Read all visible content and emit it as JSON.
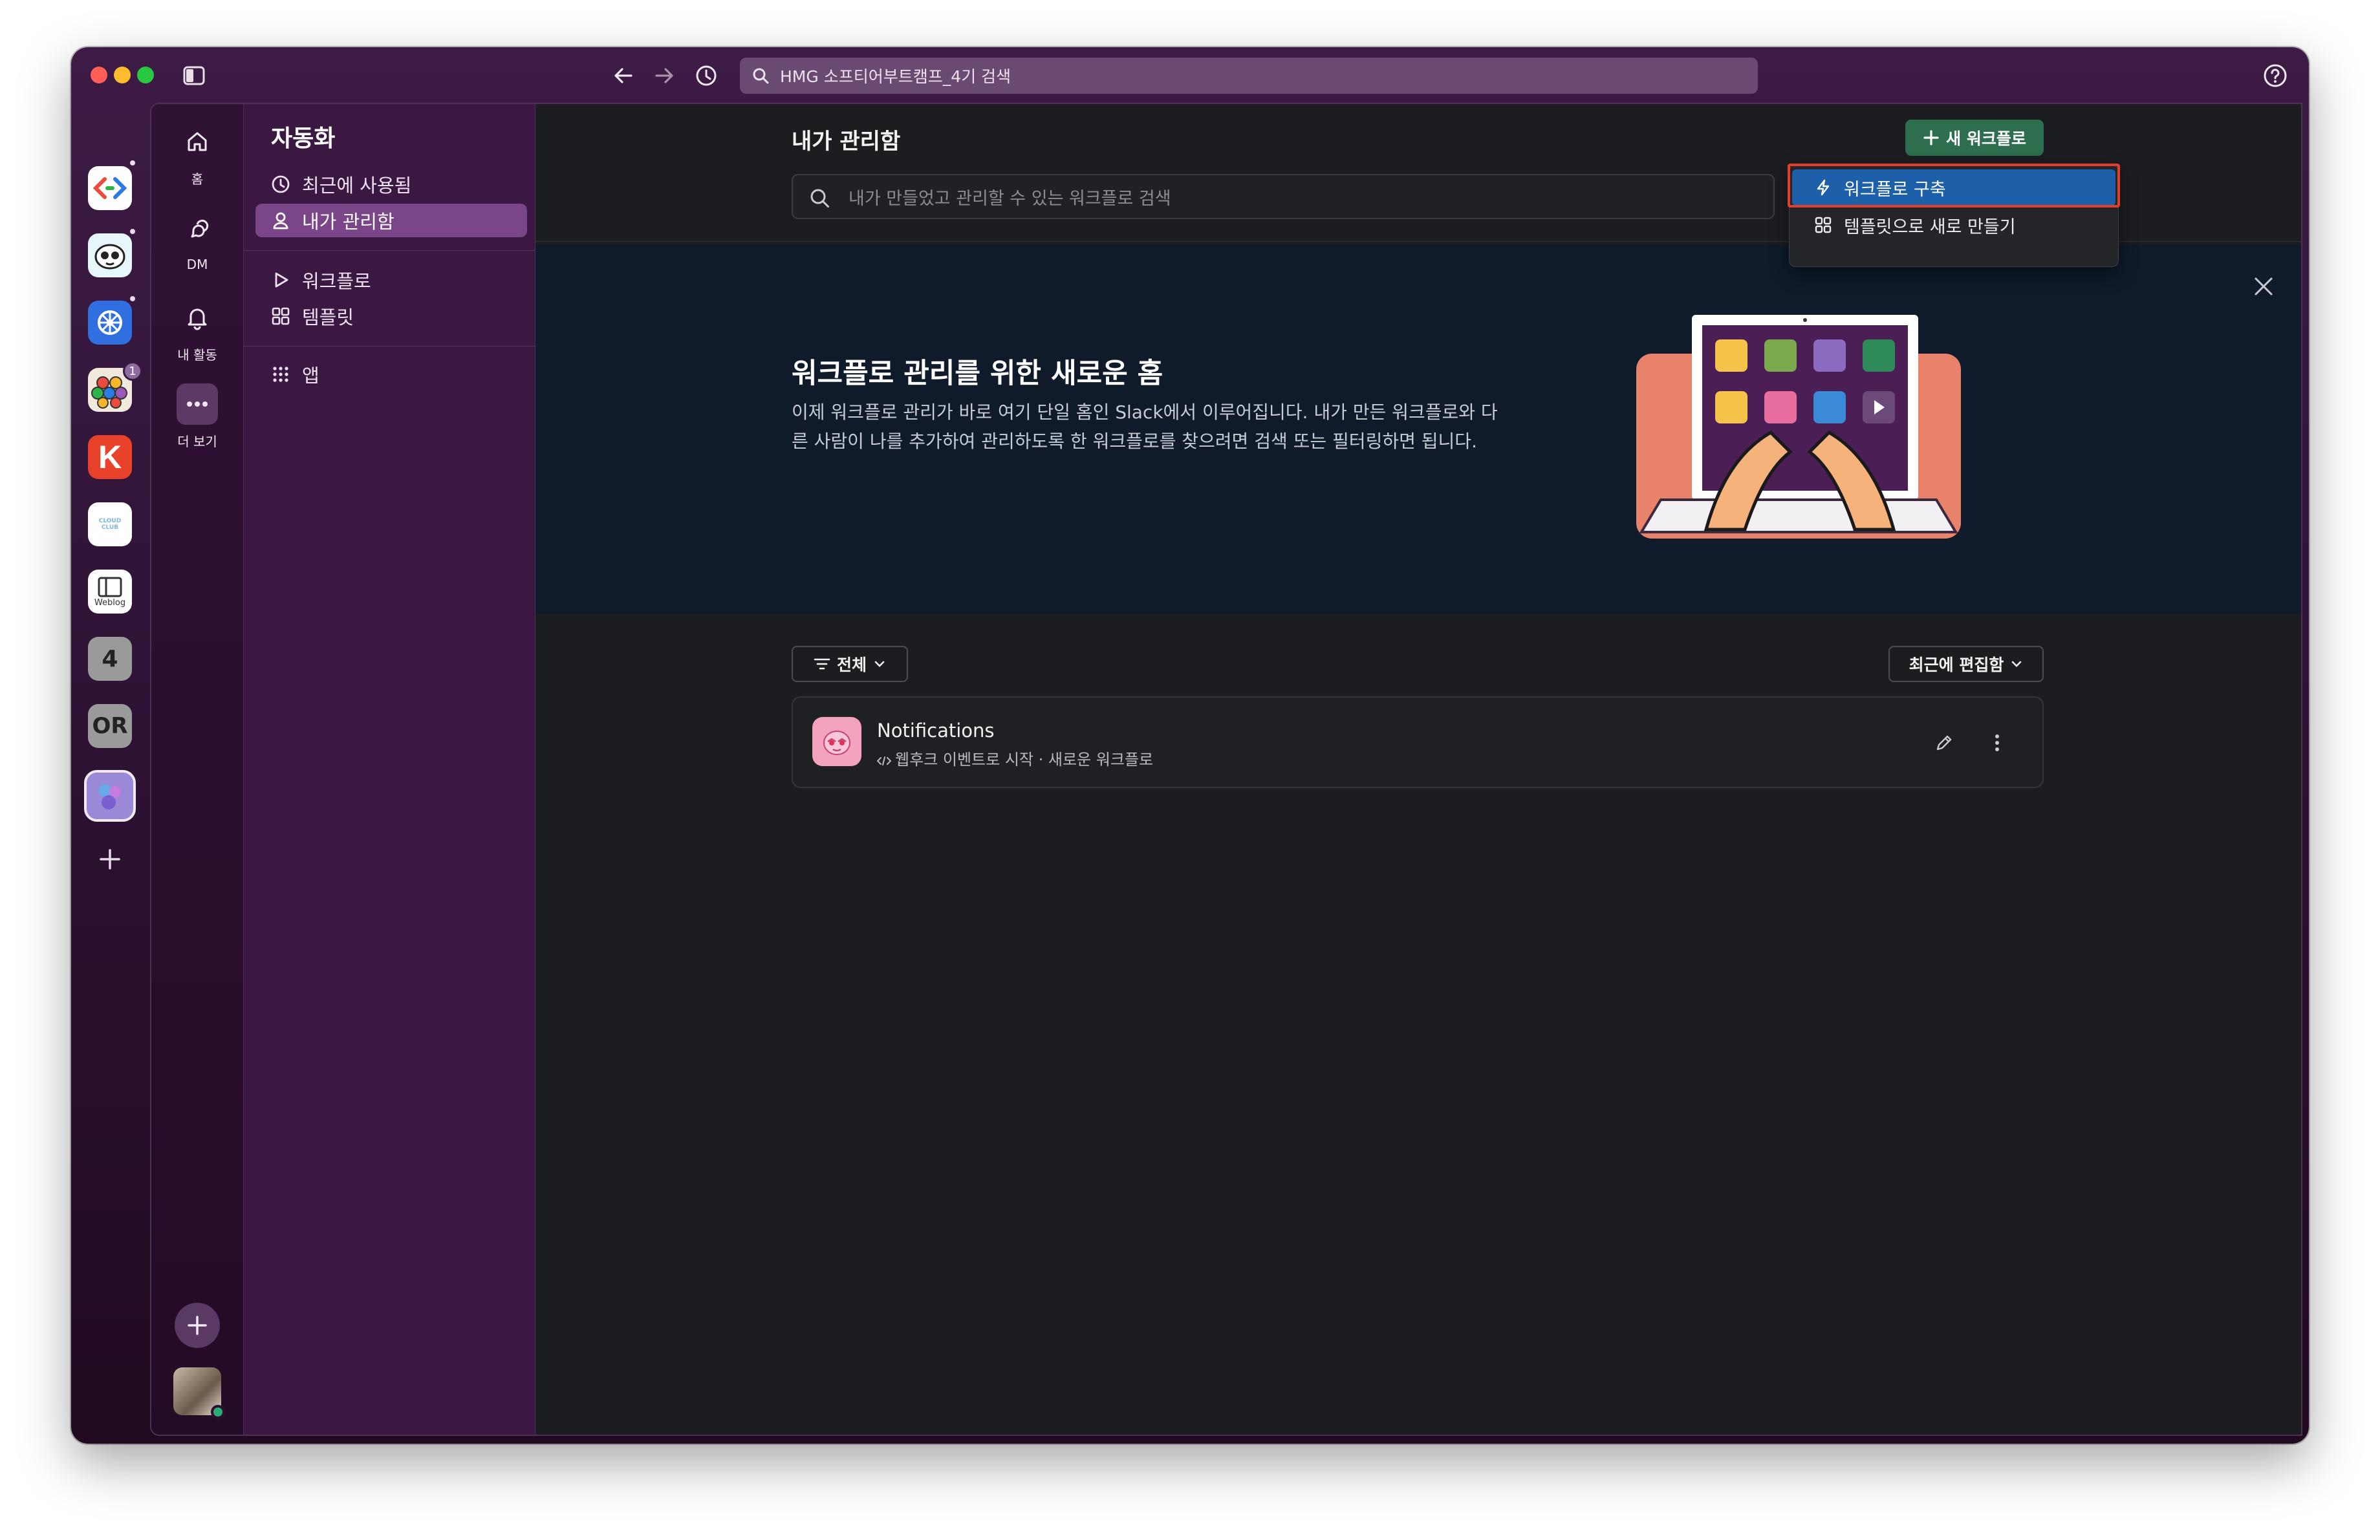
{
  "titlebar": {
    "search_text": "HMG 소프티어부트캠프_4기 검색"
  },
  "workspaces": [
    {
      "name": "code-workspace",
      "label": "",
      "color": "#ffffff"
    },
    {
      "name": "mascot-workspace",
      "label": "",
      "color": "#e7f6fb"
    },
    {
      "name": "kubernetes-workspace",
      "label": "",
      "color": "#2f6fe0"
    },
    {
      "name": "hexagon-workspace",
      "label": "",
      "color": "#f0e9dc",
      "badge": "1"
    },
    {
      "name": "k-workspace",
      "label": "K",
      "color": "#e8422a"
    },
    {
      "name": "cloud-club-workspace",
      "label": "CLOUD CLUB",
      "color": "#ffffff"
    },
    {
      "name": "weblog-workspace",
      "label": "Weblog",
      "color": "#ffffff"
    },
    {
      "name": "four-workspace",
      "label": "4",
      "color": "#9a9a9a"
    },
    {
      "name": "or-workspace",
      "label": "OR",
      "color": "#9a9a9a"
    },
    {
      "name": "active-workspace",
      "label": "",
      "color": "#9b88d6"
    }
  ],
  "nav": {
    "home": "홈",
    "dm": "DM",
    "activity": "내 활동",
    "more": "더 보기"
  },
  "sidebar": {
    "title": "자동화",
    "items": [
      {
        "label": "최근에 사용됨"
      },
      {
        "label": "내가 관리함"
      },
      {
        "label": "워크플로"
      },
      {
        "label": "템플릿"
      },
      {
        "label": "앱"
      }
    ]
  },
  "main": {
    "title": "내가 관리함",
    "new_workflow_label": "새 워크플로",
    "search_placeholder": "내가 만들었고 관리할 수 있는 워크플로 검색",
    "dropdown": [
      {
        "label": "워크플로 구축"
      },
      {
        "label": "템플릿으로 새로 만들기"
      }
    ],
    "banner": {
      "title": "워크플로 관리를 위한 새로운 홈",
      "text": "이제 워크플로 관리가 바로 여기 단일 홈인 Slack에서 이루어집니다. 내가 만든 워크플로와 다른 사람이 나를 추가하여 관리하도록 한 워크플로를 찾으려면 검색 또는 필터링하면 됩니다."
    },
    "filter_label": "전체",
    "sort_label": "최근에 편집함",
    "workflows": [
      {
        "name": "Notifications",
        "subtitle": "웹후크 이벤트로 시작 · 새로운 워크플로"
      }
    ]
  },
  "colors": {
    "accent_green": "#2c6e4d",
    "active_sidebar": "#7a4689",
    "dropdown_highlight": "#1d5fa8",
    "annotation_red": "#e0402b"
  }
}
